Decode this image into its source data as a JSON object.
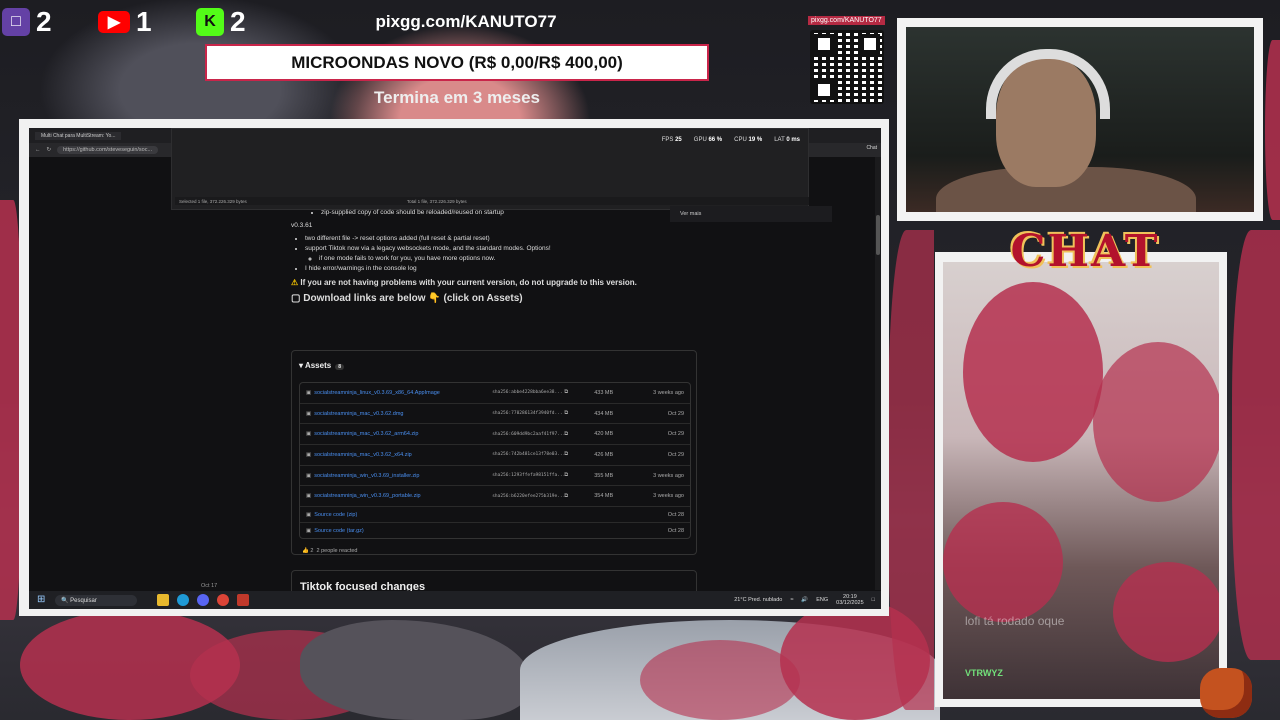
{
  "counters": [
    {
      "platform": "twitch-icon",
      "count": "2",
      "color": "#6441a5"
    },
    {
      "platform": "youtube-icon",
      "count": "1",
      "color": "#ff0000"
    },
    {
      "platform": "kick-icon",
      "count": "2",
      "color": "#53fc18"
    }
  ],
  "header": {
    "site": "pixgg.com/KANUTO77",
    "goal": "MICROONDAS NOVO (R$ 0,00/R$ 400,00)",
    "ends": "Termina em 3 meses",
    "qr_label": "pixgg.com/KANUTO77"
  },
  "chat": {
    "title": "CHAT",
    "ghost_message": "lofi tá rodado oque",
    "username": "VTRWYZ"
  },
  "browser": {
    "tab_title": "Multi Chat para MultiStream: Yo...",
    "url": "https://github.com/steveseguin/soc...",
    "chat_button": "Chat",
    "stats": {
      "fps_label": "FPS",
      "fps": "25",
      "gpu_label": "GPU",
      "gpu": "66 %",
      "cpu_label": "CPU",
      "cpu": "19 %",
      "lat_label": "LAT",
      "lat": "0 ms"
    },
    "status_left": "Selected 1 file, 372.226.329 bytes",
    "status_right": "Total 1 file, 372.226.329 bytes",
    "ver_mais": "Ver mais"
  },
  "release": {
    "line0": "zip-supplied copy of code should be reloaded/reused on startup",
    "version": "v0.3.61",
    "bullets": [
      "two different file -> reset options added (full reset & partial reset)",
      "support Tiktok now via a legacy websockets mode, and the standard modes. Options!",
      "I hide error/warnings in the console log"
    ],
    "sub_bullet": "if one mode fails to work for you, you have more options now.",
    "warning": "If you are not having problems with your current version, do not upgrade to this version.",
    "download": "Download links are below 👇 (click on Assets)",
    "assets_label": "Assets",
    "assets_count": "8",
    "assets": [
      {
        "name": "socialstreamninja_linux_v0.3.69_x86_64.AppImage",
        "sha": "sha256:abbe4228bba6ee38...",
        "size": "433 MB",
        "date": "3 weeks ago"
      },
      {
        "name": "socialstreamninja_mac_v0.3.62.dmg",
        "sha": "sha256:770286134f3940fd...",
        "size": "434 MB",
        "date": "Oct 29"
      },
      {
        "name": "socialstreamninja_mac_v0.3.62_arm64.zip",
        "sha": "sha256:609dd9bc2aaf41f97...",
        "size": "420 MB",
        "date": "Oct 29"
      },
      {
        "name": "socialstreamninja_mac_v0.3.62_x64.zip",
        "sha": "sha256:742b481ce13f78e03...",
        "size": "426 MB",
        "date": "Oct 29"
      },
      {
        "name": "socialstreamninja_win_v0.3.69_installer.zip",
        "sha": "sha256:1293ffefa98151ffa...",
        "size": "355 MB",
        "date": "3 weeks ago"
      },
      {
        "name": "socialstreamninja_win_v0.3.69_portable.zip",
        "sha": "sha256:b6220efee275b319e...",
        "size": "354 MB",
        "date": "3 weeks ago"
      },
      {
        "name": "Source code (zip)",
        "sha": "",
        "size": "",
        "date": "Oct 28"
      },
      {
        "name": "Source code (tar.gz)",
        "sha": "",
        "size": "",
        "date": "Oct 28"
      }
    ],
    "reaction_count": "2",
    "reacted": "2 people reacted",
    "next_date": "Oct 17",
    "next_title": "Tiktok focused changes"
  },
  "taskbar": {
    "search": "Pesquisar",
    "weather": "21°C  Pred. nublado",
    "lang": "ENG",
    "time": "20:19",
    "date": "03/12/2025"
  }
}
